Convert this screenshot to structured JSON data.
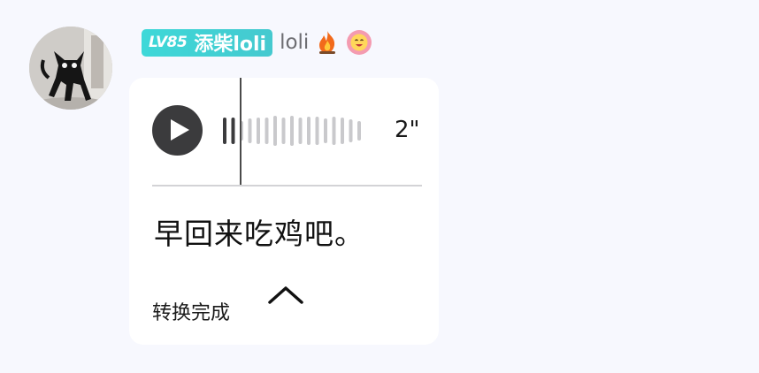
{
  "message": {
    "badge": {
      "level": "LV85",
      "name": "添柴loli",
      "color": "#3ed8d8"
    },
    "username": "loli",
    "icons": [
      "fire-icon",
      "smile-emoji-icon"
    ],
    "voice": {
      "duration": "2\"",
      "progress": 0.09
    },
    "transcript": "早回来吃鸡吧。",
    "status_label": "转换完成"
  }
}
